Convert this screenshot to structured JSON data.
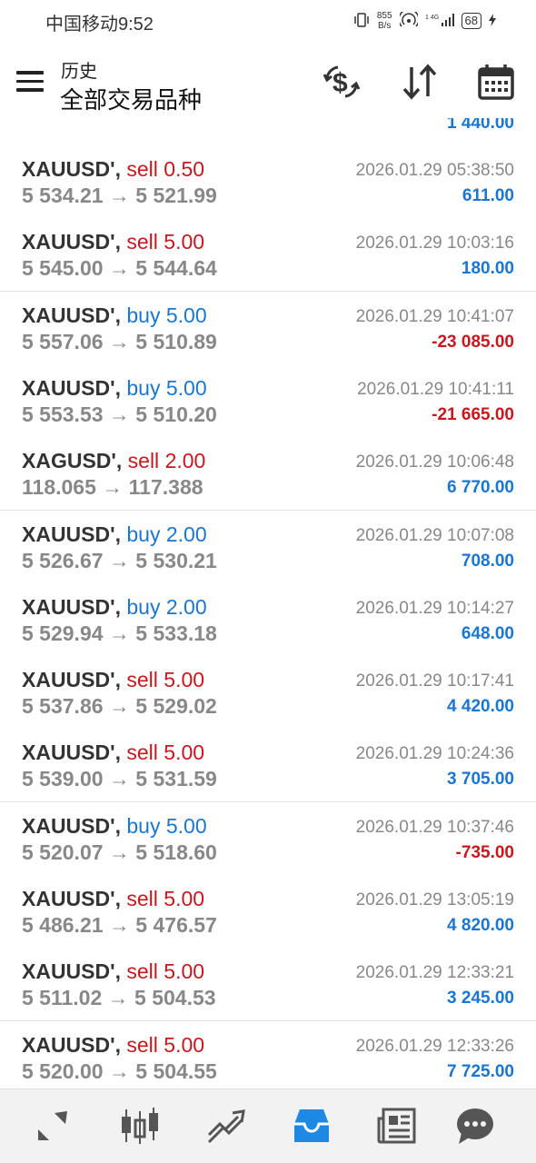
{
  "status_bar": {
    "carrier_time": "中国移动9:52",
    "net_speed_value": "855",
    "net_speed_unit": "B/s",
    "battery": "68"
  },
  "header": {
    "title_small": "历史",
    "title_big": "全部交易品种"
  },
  "trades": [
    {
      "symbol": "XAUUSD'",
      "side": "sell",
      "volume": "0.50",
      "prices": "5 534.21 → 5 521.99",
      "time": "2026.01.29 05:38:50",
      "profit": "611.00",
      "neg": false
    },
    {
      "symbol": "XAUUSD'",
      "side": "sell",
      "volume": "5.00",
      "prices": "5 545.00 → 5 544.64",
      "time": "2026.01.29 10:03:16",
      "profit": "180.00",
      "neg": false
    },
    {
      "symbol": "XAUUSD'",
      "side": "buy",
      "volume": "5.00",
      "prices": "5 557.06 → 5 510.89",
      "time": "2026.01.29 10:41:07",
      "profit": "-23 085.00",
      "neg": true
    },
    {
      "symbol": "XAUUSD'",
      "side": "buy",
      "volume": "5.00",
      "prices": "5 553.53 → 5 510.20",
      "time": "2026.01.29 10:41:11",
      "profit": "-21 665.00",
      "neg": true
    },
    {
      "symbol": "XAGUSD'",
      "side": "sell",
      "volume": "2.00",
      "prices": "118.065 → 117.388",
      "time": "2026.01.29 10:06:48",
      "profit": "6 770.00",
      "neg": false
    },
    {
      "symbol": "XAUUSD'",
      "side": "buy",
      "volume": "2.00",
      "prices": "5 526.67 → 5 530.21",
      "time": "2026.01.29 10:07:08",
      "profit": "708.00",
      "neg": false
    },
    {
      "symbol": "XAUUSD'",
      "side": "buy",
      "volume": "2.00",
      "prices": "5 529.94 → 5 533.18",
      "time": "2026.01.29 10:14:27",
      "profit": "648.00",
      "neg": false
    },
    {
      "symbol": "XAUUSD'",
      "side": "sell",
      "volume": "5.00",
      "prices": "5 537.86 → 5 529.02",
      "time": "2026.01.29 10:17:41",
      "profit": "4 420.00",
      "neg": false
    },
    {
      "symbol": "XAUUSD'",
      "side": "sell",
      "volume": "5.00",
      "prices": "5 539.00 → 5 531.59",
      "time": "2026.01.29 10:24:36",
      "profit": "3 705.00",
      "neg": false
    },
    {
      "symbol": "XAUUSD'",
      "side": "buy",
      "volume": "5.00",
      "prices": "5 520.07 → 5 518.60",
      "time": "2026.01.29 10:37:46",
      "profit": "-735.00",
      "neg": true
    },
    {
      "symbol": "XAUUSD'",
      "side": "sell",
      "volume": "5.00",
      "prices": "5 486.21 → 5 476.57",
      "time": "2026.01.29 13:05:19",
      "profit": "4 820.00",
      "neg": false
    },
    {
      "symbol": "XAUUSD'",
      "side": "sell",
      "volume": "5.00",
      "prices": "5 511.02 → 5 504.53",
      "time": "2026.01.29 12:33:21",
      "profit": "3 245.00",
      "neg": false
    },
    {
      "symbol": "XAUUSD'",
      "side": "sell",
      "volume": "5.00",
      "prices": "5 520.00 → 5 504.55",
      "time": "2026.01.29 12:33:26",
      "profit": "7 725.00",
      "neg": false
    }
  ],
  "partial_row_profit": "1 440.00",
  "bottom_nav": [
    "quotes-icon",
    "chart-icon",
    "trade-icon",
    "history-icon",
    "news-icon",
    "chat-icon"
  ],
  "active_nav": "history-icon",
  "colors": {
    "sell": "#c8181e",
    "buy": "#1976d2",
    "accent": "#1e88e5"
  }
}
